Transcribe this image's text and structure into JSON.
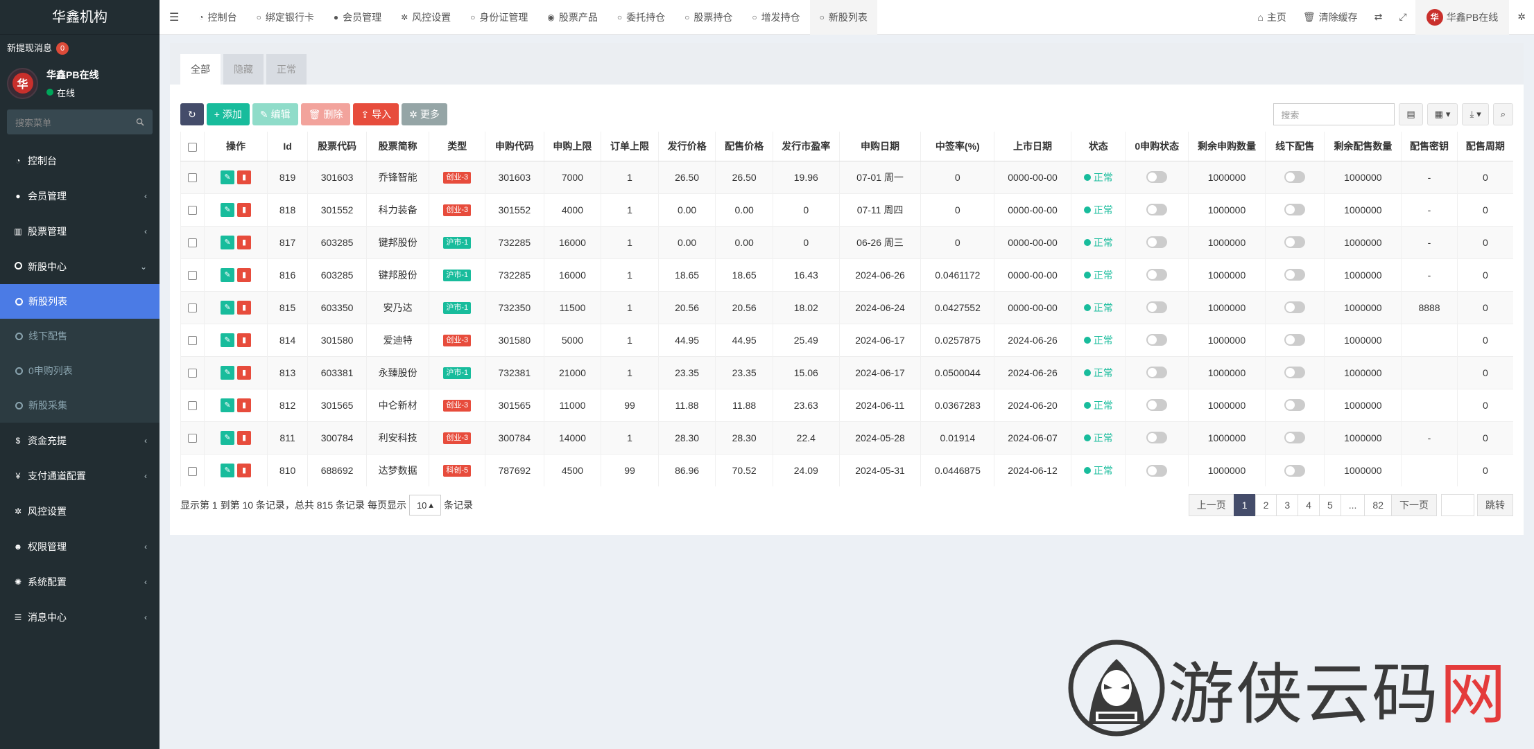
{
  "sidebar": {
    "logo": "华鑫机构",
    "msg_label": "新提现消息",
    "msg_count": "0",
    "user_name": "华鑫PB在线",
    "user_status": "在线",
    "avatar_char": "华",
    "search_placeholder": "搜索菜单",
    "items": [
      {
        "label": "控制台",
        "icon": "dashboard-icon"
      },
      {
        "label": "会员管理",
        "icon": "user-circle-icon"
      },
      {
        "label": "股票管理",
        "icon": "bank-icon"
      },
      {
        "label": "新股中心",
        "icon": "circle-icon"
      },
      {
        "label": "资金充提",
        "icon": "dollar-icon"
      },
      {
        "label": "支付通道配置",
        "icon": "yen-icon"
      },
      {
        "label": "风控设置",
        "icon": "gear-icon"
      },
      {
        "label": "权限管理",
        "icon": "users-icon"
      },
      {
        "label": "系统配置",
        "icon": "cog-icon"
      },
      {
        "label": "消息中心",
        "icon": "list-icon"
      }
    ],
    "sub_items": [
      "新股列表",
      "线下配售",
      "0申购列表",
      "新股采集"
    ]
  },
  "topnav": {
    "tabs": [
      "控制台",
      "绑定银行卡",
      "会员管理",
      "风控设置",
      "身份证管理",
      "股票产品",
      "委托持仓",
      "股票持仓",
      "增发持仓",
      "新股列表"
    ],
    "home": "主页",
    "clear_cache": "清除缓存",
    "user": "华鑫PB在线"
  },
  "content": {
    "tabs": [
      "全部",
      "隐藏",
      "正常"
    ],
    "buttons": {
      "add": "添加",
      "edit": "编辑",
      "delete": "删除",
      "import": "导入",
      "more": "更多"
    },
    "search_placeholder": "搜索",
    "columns": [
      "操作",
      "Id",
      "股票代码",
      "股票简称",
      "类型",
      "申购代码",
      "申购上限",
      "订单上限",
      "发行价格",
      "配售价格",
      "发行市盈率",
      "申购日期",
      "中签率(%)",
      "上市日期",
      "状态",
      "0申购状态",
      "剩余申购数量",
      "线下配售",
      "剩余配售数量",
      "配售密钥",
      "配售周期"
    ],
    "rows": [
      {
        "id": "819",
        "code": "301603",
        "name": "乔锋智能",
        "type": "创业-3",
        "type_color": "red",
        "sg_code": "301603",
        "sg_limit": "7000",
        "order_limit": "1",
        "price": "26.50",
        "ps_price": "26.50",
        "pe": "19.96",
        "sg_date": "07-01 周一",
        "rate": "0",
        "list_date": "0000-00-00",
        "status": "正常",
        "remain_sg": "1000000",
        "remain_ps": "1000000",
        "key": "-",
        "cycle": "0"
      },
      {
        "id": "818",
        "code": "301552",
        "name": "科力装备",
        "type": "创业-3",
        "type_color": "red",
        "sg_code": "301552",
        "sg_limit": "4000",
        "order_limit": "1",
        "price": "0.00",
        "ps_price": "0.00",
        "pe": "0",
        "sg_date": "07-11 周四",
        "rate": "0",
        "list_date": "0000-00-00",
        "status": "正常",
        "remain_sg": "1000000",
        "remain_ps": "1000000",
        "key": "-",
        "cycle": "0"
      },
      {
        "id": "817",
        "code": "603285",
        "name": "键邦股份",
        "type": "沪市-1",
        "type_color": "green",
        "sg_code": "732285",
        "sg_limit": "16000",
        "order_limit": "1",
        "price": "0.00",
        "ps_price": "0.00",
        "pe": "0",
        "sg_date": "06-26 周三",
        "rate": "0",
        "list_date": "0000-00-00",
        "status": "正常",
        "remain_sg": "1000000",
        "remain_ps": "1000000",
        "key": "-",
        "cycle": "0"
      },
      {
        "id": "816",
        "code": "603285",
        "name": "键邦股份",
        "type": "沪市-1",
        "type_color": "green",
        "sg_code": "732285",
        "sg_limit": "16000",
        "order_limit": "1",
        "price": "18.65",
        "ps_price": "18.65",
        "pe": "16.43",
        "sg_date": "2024-06-26",
        "rate": "0.0461172",
        "list_date": "0000-00-00",
        "status": "正常",
        "remain_sg": "1000000",
        "remain_ps": "1000000",
        "key": "-",
        "cycle": "0"
      },
      {
        "id": "815",
        "code": "603350",
        "name": "安乃达",
        "type": "沪市-1",
        "type_color": "green",
        "sg_code": "732350",
        "sg_limit": "11500",
        "order_limit": "1",
        "price": "20.56",
        "ps_price": "20.56",
        "pe": "18.02",
        "sg_date": "2024-06-24",
        "rate": "0.0427552",
        "list_date": "0000-00-00",
        "status": "正常",
        "remain_sg": "1000000",
        "remain_ps": "1000000",
        "key": "8888",
        "cycle": "0"
      },
      {
        "id": "814",
        "code": "301580",
        "name": "爱迪特",
        "type": "创业-3",
        "type_color": "red",
        "sg_code": "301580",
        "sg_limit": "5000",
        "order_limit": "1",
        "price": "44.95",
        "ps_price": "44.95",
        "pe": "25.49",
        "sg_date": "2024-06-17",
        "rate": "0.0257875",
        "list_date": "2024-06-26",
        "status": "正常",
        "remain_sg": "1000000",
        "remain_ps": "1000000",
        "key": "",
        "cycle": "0"
      },
      {
        "id": "813",
        "code": "603381",
        "name": "永臻股份",
        "type": "沪市-1",
        "type_color": "green",
        "sg_code": "732381",
        "sg_limit": "21000",
        "order_limit": "1",
        "price": "23.35",
        "ps_price": "23.35",
        "pe": "15.06",
        "sg_date": "2024-06-17",
        "rate": "0.0500044",
        "list_date": "2024-06-26",
        "status": "正常",
        "remain_sg": "1000000",
        "remain_ps": "1000000",
        "key": "",
        "cycle": "0"
      },
      {
        "id": "812",
        "code": "301565",
        "name": "中仑新材",
        "type": "创业-3",
        "type_color": "red",
        "sg_code": "301565",
        "sg_limit": "11000",
        "order_limit": "99",
        "price": "11.88",
        "ps_price": "11.88",
        "pe": "23.63",
        "sg_date": "2024-06-11",
        "rate": "0.0367283",
        "list_date": "2024-06-20",
        "status": "正常",
        "remain_sg": "1000000",
        "remain_ps": "1000000",
        "key": "",
        "cycle": "0"
      },
      {
        "id": "811",
        "code": "300784",
        "name": "利安科技",
        "type": "创业-3",
        "type_color": "red",
        "sg_code": "300784",
        "sg_limit": "14000",
        "order_limit": "1",
        "price": "28.30",
        "ps_price": "28.30",
        "pe": "22.4",
        "sg_date": "2024-05-28",
        "rate": "0.01914",
        "list_date": "2024-06-07",
        "status": "正常",
        "remain_sg": "1000000",
        "remain_ps": "1000000",
        "key": "-",
        "cycle": "0"
      },
      {
        "id": "810",
        "code": "688692",
        "name": "达梦数据",
        "type": "科创-5",
        "type_color": "red",
        "sg_code": "787692",
        "sg_limit": "4500",
        "order_limit": "99",
        "price": "86.96",
        "ps_price": "70.52",
        "pe": "24.09",
        "sg_date": "2024-05-31",
        "rate": "0.0446875",
        "list_date": "2024-06-12",
        "status": "正常",
        "remain_sg": "1000000",
        "remain_ps": "1000000",
        "key": "",
        "cycle": "0"
      }
    ],
    "footer": {
      "summary": "显示第 1 到第 10 条记录，总共 815 条记录 每页显示",
      "page_size": "10",
      "suffix": "条记录",
      "prev": "上一页",
      "pages": [
        "1",
        "2",
        "3",
        "4",
        "5",
        "...",
        "82"
      ],
      "next": "下一页",
      "jump": "跳转"
    }
  },
  "watermark": {
    "text_dark": "游侠云码",
    "text_red": "网"
  },
  "colors": {
    "sidebar_bg": "#222d32",
    "accent_blue": "#4b7be5",
    "green": "#18bc9c",
    "red": "#e74c3c",
    "dark_btn": "#444c6a"
  }
}
